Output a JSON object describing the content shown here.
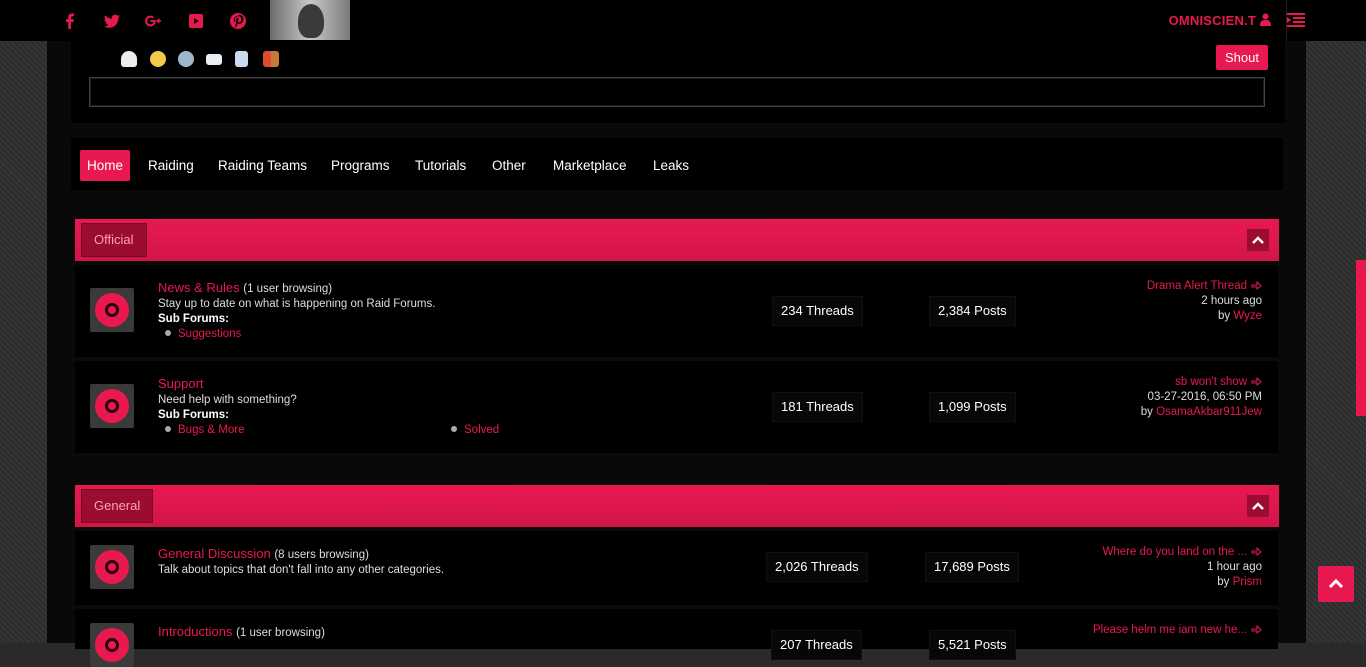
{
  "topbar": {
    "social_icons": [
      "facebook-icon",
      "twitter-icon",
      "google-plus-icon",
      "youtube-icon",
      "pinterest-icon"
    ],
    "username": "OMNISCIEN.T"
  },
  "shoutbox": {
    "toolbar_icons": [
      "ghost-icon",
      "smiley-icon",
      "gear-icon",
      "mail-icon",
      "document-icon",
      "exit-icon"
    ],
    "shout_label": "Shout",
    "input_value": ""
  },
  "nav": {
    "items": [
      {
        "label": "Home",
        "active": true
      },
      {
        "label": "Raiding"
      },
      {
        "label": "Raiding Teams"
      },
      {
        "label": "Programs"
      },
      {
        "label": "Tutorials"
      },
      {
        "label": "Other"
      },
      {
        "label": "Marketplace"
      },
      {
        "label": "Leaks"
      }
    ]
  },
  "categories": [
    {
      "name": "Official",
      "forums": [
        {
          "title": "News & Rules",
          "browsing": "(1 user browsing)",
          "description": "Stay up to date on what is happening on Raid Forums.",
          "sub_label": "Sub Forums:",
          "subforums": [
            "Suggestions"
          ],
          "threads": "234 Threads",
          "posts": "2,384 Posts",
          "last_title": "Drama Alert Thread",
          "last_time": "2 hours ago",
          "last_by_prefix": "by",
          "last_by": "Wyze"
        },
        {
          "title": "Support",
          "browsing": "",
          "description": "Need help with something?",
          "sub_label": "Sub Forums:",
          "subforums": [
            "Bugs & More",
            "Solved"
          ],
          "threads": "181 Threads",
          "posts": "1,099 Posts",
          "last_title": "sb won't show",
          "last_time": "03-27-2016, 06:50 PM",
          "last_by_prefix": "by",
          "last_by": "OsamaAkbar911Jew"
        }
      ]
    },
    {
      "name": "General",
      "forums": [
        {
          "title": "General Discussion",
          "browsing": "(8 users browsing)",
          "description": "Talk about topics that don't fall into any other categories.",
          "threads": "2,026 Threads",
          "posts": "17,689 Posts",
          "last_title": "Where do you land on the ...",
          "last_time": "1 hour ago",
          "last_by_prefix": "by",
          "last_by": "Prism"
        },
        {
          "title": "Introductions",
          "browsing": "(1 user browsing)",
          "description": "",
          "threads": "207 Threads",
          "posts": "5,521 Posts",
          "last_title": "Please helm me iam new he...",
          "last_time": "",
          "last_by_prefix": "",
          "last_by": ""
        }
      ]
    }
  ],
  "colors": {
    "accent": "#e8194f",
    "background": "#090909",
    "panel": "#000000"
  }
}
